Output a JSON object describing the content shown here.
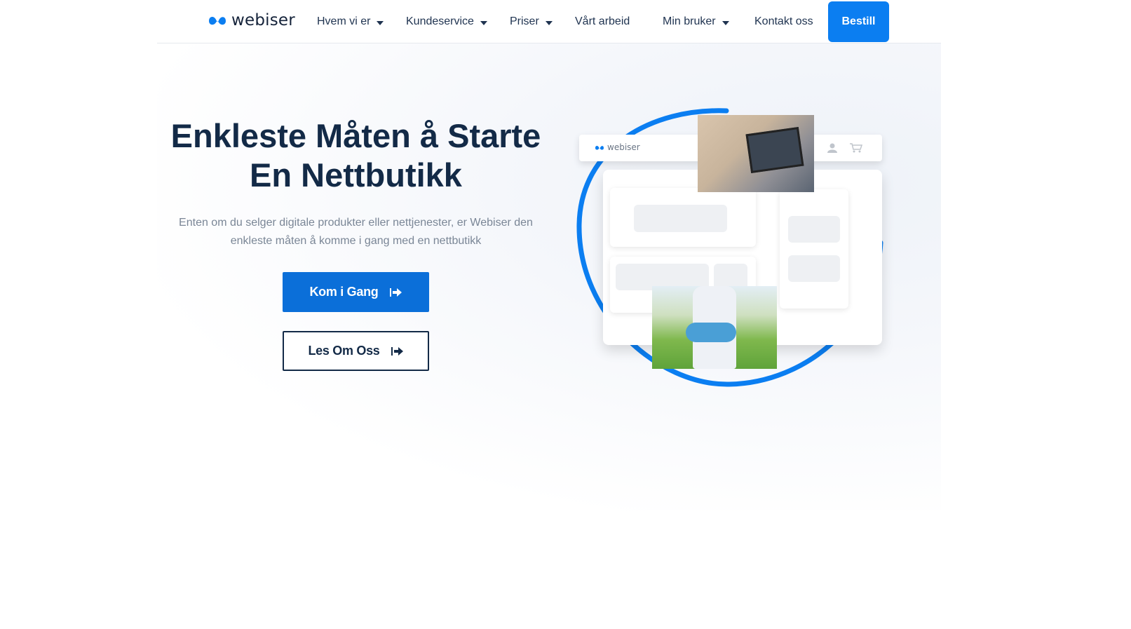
{
  "brand": {
    "name": "webiser",
    "accent": "#0b7ef1",
    "dark": "#132a47"
  },
  "nav": {
    "items": [
      {
        "label": "Hvem vi er",
        "dropdown": true
      },
      {
        "label": "Kundeservice",
        "dropdown": true
      },
      {
        "label": "Priser",
        "dropdown": true
      },
      {
        "label": "Vårt arbeid",
        "dropdown": false
      },
      {
        "label": "Min bruker",
        "dropdown": true
      },
      {
        "label": "Kontakt oss",
        "dropdown": false
      }
    ],
    "cta_label": "Bestill"
  },
  "hero": {
    "title_line1": "Enkleste Måten å Starte",
    "title_line2": "En Nettbutikk",
    "subtitle": "Enten om du selger digitale produkter eller nettjenester, er Webiser den enkleste måten å komme i gang med en nettbutikk",
    "primary_button": "Kom i Gang",
    "secondary_button": "Les Om Oss"
  },
  "illustration": {
    "brand": "webiser",
    "icons": [
      "user-icon",
      "cart-icon",
      "arrow-right-icon"
    ]
  }
}
